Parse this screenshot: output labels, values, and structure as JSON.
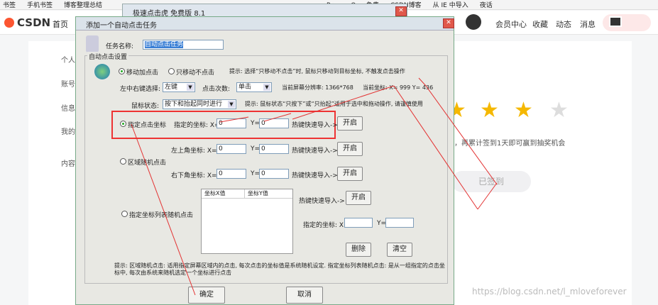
{
  "bookmarks": [
    "书签",
    "手机书签",
    "博客整理总结",
    "ProcessOn - 免费",
    "CSDN博客",
    "从 IE 中导入",
    "夜话"
  ],
  "header": {
    "logo": "CSDN",
    "home": "首页",
    "nav_right": [
      "会员中心",
      "收藏",
      "动态",
      "消息"
    ]
  },
  "page": {
    "side_items": [
      "个人",
      "账号",
      "信息",
      "我的",
      "内容"
    ],
    "sign_note": "天，再累计签到1天即可赢到抽奖机会",
    "signed_label": "已签到",
    "watermark": "https://blog.csdn.net/l_mloveforever",
    "stars_filled": 3,
    "stars_total": 4
  },
  "back_dialog": {
    "title": "极速点击虎 免费版 8.1"
  },
  "dialog": {
    "title": "添加一个自动点击任务",
    "task_name_label": "任务名称:",
    "task_name_value": "自动点击任务",
    "group_label": "自动点击设置",
    "move_click": "移动加点击",
    "move_only": "只移动不点击",
    "hint1": "提示: 选择“只移动不点击”时, 鼠标只移动到目标坐标, 不触发点击操作",
    "lr_label": "左中右键选择:",
    "lr_value": "左键",
    "count_label": "点击次数:",
    "count_value": "单击",
    "resolution": "当前屏幕分辨率: 1366*768",
    "cur_coord": "当前坐标: X= 999  Y= 436",
    "mouse_state_label": "鼠标状态:",
    "mouse_state_value": "按下和抬起同时进行",
    "hint2": "提示: 鼠标状态“只按下”或“只抬起”适用于选中和拖动操作, 请谨慎使用",
    "fixed_coord": "指定点击坐标",
    "target_coord": "指定的坐标: X=",
    "x_val": "0",
    "y_label": "Y=",
    "y_val": "0",
    "hotkey_import": "热键快速导入->",
    "start": "开启",
    "area_random": "区域随机点击",
    "top_left": "左上角坐标: X=",
    "bottom_right": "右下角坐标: X=",
    "list_random": "指定坐标列表随机点击",
    "col_x": "坐标X值",
    "col_y": "坐标Y值",
    "coord2_x": "指定的坐标: X=",
    "delete": "删除",
    "clear": "清空",
    "hint3": "提示: 区域随机点击: 适用指定屏幕区域内的点击, 每次点击的坐标值是系统随机设定. 指定坐标列表随机点击: 是从一组指定的点击坐标中, 每次由系统来随机选定一个坐标进行点击",
    "ok": "确定",
    "cancel": "取消"
  },
  "colors": {
    "accent_red": "#e33333",
    "csdn_red": "#fc5531",
    "star": "#f5b800"
  }
}
